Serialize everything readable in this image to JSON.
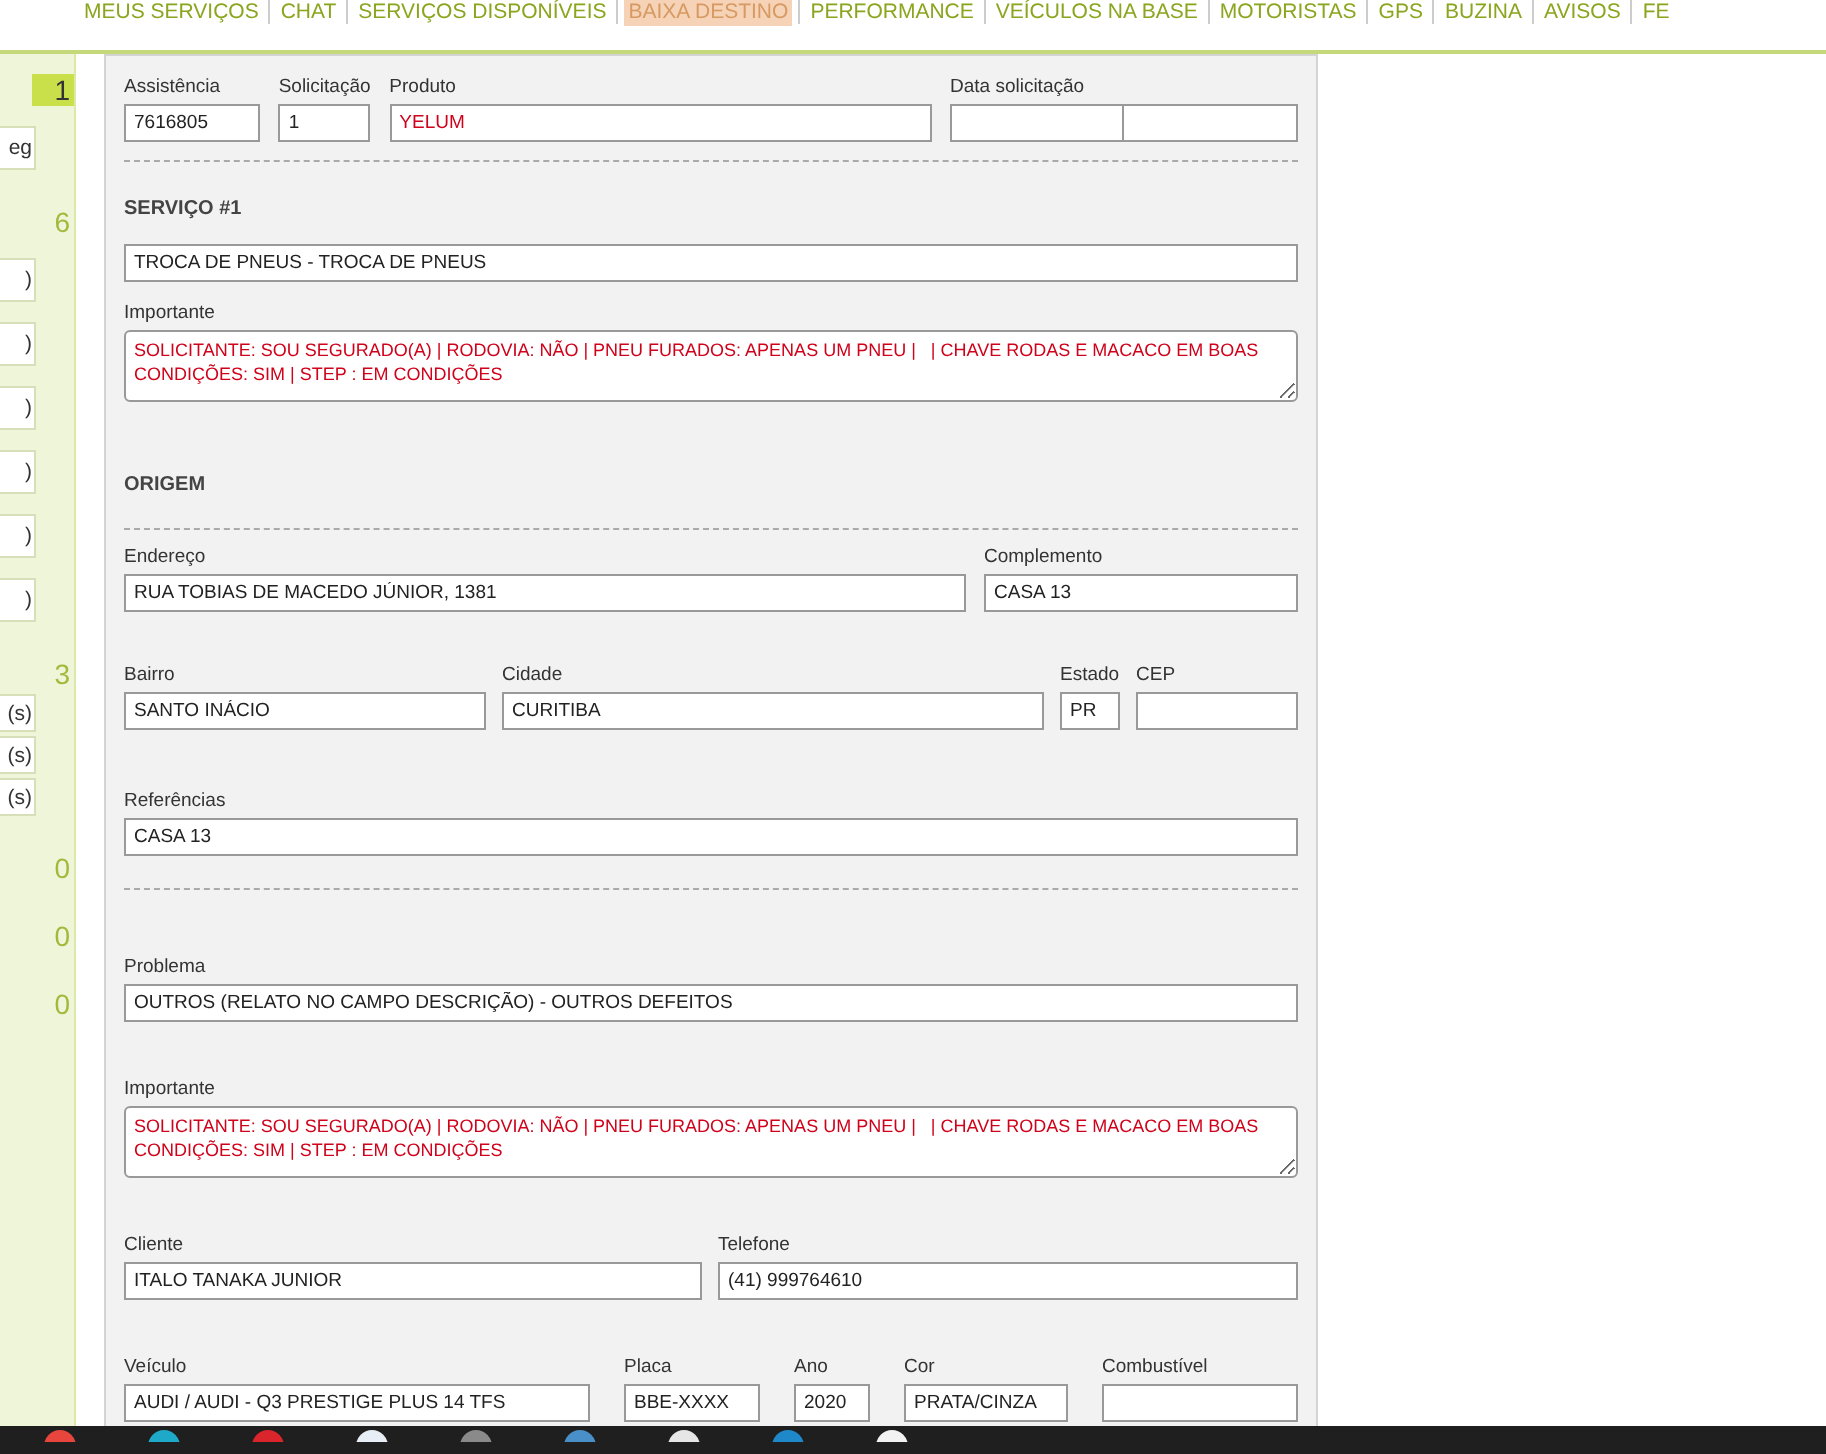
{
  "nav": [
    {
      "label": "MEUS SERVIÇOS",
      "selected": false
    },
    {
      "label": "CHAT",
      "selected": false
    },
    {
      "label": "SERVIÇOS DISPONÍVEIS",
      "selected": false
    },
    {
      "label": "BAIXA DESTINO",
      "selected": true
    },
    {
      "label": "PERFORMANCE",
      "selected": false
    },
    {
      "label": "VEÍCULOS NA BASE",
      "selected": false
    },
    {
      "label": "MOTORISTAS",
      "selected": false
    },
    {
      "label": "GPS",
      "selected": false
    },
    {
      "label": "BUZINA",
      "selected": false
    },
    {
      "label": "AVISOS",
      "selected": false
    },
    {
      "label": "FE",
      "selected": false
    }
  ],
  "sidebar": [
    {
      "kind": "count",
      "text": "1",
      "highlighted": true
    },
    {
      "kind": "box",
      "text": "eg"
    },
    {
      "kind": "count",
      "text": "6",
      "highlighted": false
    },
    {
      "kind": "box",
      "text": ")"
    },
    {
      "kind": "box",
      "text": ")"
    },
    {
      "kind": "box",
      "text": ")"
    },
    {
      "kind": "box",
      "text": ")"
    },
    {
      "kind": "box",
      "text": ")"
    },
    {
      "kind": "box",
      "text": ")"
    },
    {
      "kind": "count",
      "text": "3",
      "highlighted": false
    },
    {
      "kind": "small",
      "text": "(s)"
    },
    {
      "kind": "small",
      "text": "(s)"
    },
    {
      "kind": "small",
      "text": "(s)"
    },
    {
      "kind": "count",
      "text": "0",
      "highlighted": false
    },
    {
      "kind": "count",
      "text": "0",
      "highlighted": false
    },
    {
      "kind": "count",
      "text": "0",
      "highlighted": false
    }
  ],
  "form": [
    {
      "kind": "fields",
      "fields": [
        {
          "kind": "input",
          "label": "Assistência",
          "value": "7616805",
          "alert": false
        },
        {
          "kind": "input",
          "label": "Solicitação",
          "value": "1",
          "alert": false
        },
        {
          "kind": "input",
          "label": "Produto",
          "value": "YELUM",
          "alert": true
        },
        {
          "kind": "split",
          "label": "Data solicitação"
        }
      ]
    },
    {
      "kind": "divider"
    },
    {
      "kind": "heading",
      "text": "SERVIÇO #1"
    },
    {
      "kind": "fields",
      "fields": [
        {
          "kind": "input",
          "value": "TROCA DE PNEUS - TROCA DE PNEUS",
          "alert": false
        }
      ]
    },
    {
      "kind": "fields",
      "fields": [
        {
          "kind": "textarea",
          "label": "Importante",
          "value": "SOLICITANTE: SOU SEGURADO(A) | RODOVIA: NÃO | PNEU FURADOS: APENAS UM PNEU |   | CHAVE RODAS E MACACO EM BOAS CONDIÇÕES: SIM | STEP : EM CONDIÇÕES",
          "alert": true
        }
      ]
    },
    {
      "kind": "heading",
      "text": "ORIGEM"
    },
    {
      "kind": "divider"
    },
    {
      "kind": "fields",
      "fields": [
        {
          "kind": "input",
          "label": "Endereço",
          "value": "RUA TOBIAS DE MACEDO JÚNIOR, 1381",
          "alert": false
        },
        {
          "kind": "input",
          "label": "Complemento",
          "value": "CASA 13",
          "alert": false
        }
      ]
    },
    {
      "kind": "fields",
      "fields": [
        {
          "kind": "input",
          "label": "Bairro",
          "value": "SANTO INÁCIO",
          "alert": false
        },
        {
          "kind": "input",
          "label": "Cidade",
          "value": "CURITIBA",
          "alert": false
        },
        {
          "kind": "input",
          "label": "Estado",
          "value": "PR",
          "alert": false
        },
        {
          "kind": "input",
          "label": "CEP"
        }
      ]
    },
    {
      "kind": "fields",
      "fields": [
        {
          "kind": "input",
          "label": "Referências",
          "value": "CASA 13",
          "alert": false
        }
      ]
    },
    {
      "kind": "divider"
    },
    {
      "kind": "fields",
      "fields": [
        {
          "kind": "input",
          "label": "Problema",
          "value": "OUTROS (RELATO NO CAMPO DESCRIÇÃO) - OUTROS DEFEITOS",
          "alert": false
        }
      ]
    },
    {
      "kind": "fields",
      "fields": [
        {
          "kind": "textarea",
          "label": "Importante",
          "value": "SOLICITANTE: SOU SEGURADO(A) | RODOVIA: NÃO | PNEU FURADOS: APENAS UM PNEU |   | CHAVE RODAS E MACACO EM BOAS CONDIÇÕES: SIM | STEP : EM CONDIÇÕES",
          "alert": true
        }
      ]
    },
    {
      "kind": "fields",
      "fields": [
        {
          "kind": "input",
          "label": "Cliente",
          "value": "ITALO TANAKA JUNIOR",
          "alert": false
        },
        {
          "kind": "input",
          "label": "Telefone",
          "value": "(41) 999764610",
          "alert": false
        }
      ]
    },
    {
      "kind": "fields",
      "fields": [
        {
          "kind": "input",
          "label": "Veículo",
          "value": "AUDI / AUDI - Q3 PRESTIGE PLUS 14 TFS",
          "alert": false
        },
        {
          "kind": "input",
          "label": "Placa",
          "value": "BBE-XXXX",
          "alert": false
        },
        {
          "kind": "input",
          "label": "Ano",
          "value": "2020",
          "alert": false
        },
        {
          "kind": "input",
          "label": "Cor",
          "value": "PRATA/CINZA",
          "alert": false
        },
        {
          "kind": "input",
          "label": "Combustível"
        }
      ]
    }
  ],
  "taskbar": [
    {
      "color": "#e8453c"
    },
    {
      "color": "#1fa9c9"
    },
    {
      "color": "#d9252b"
    },
    {
      "color": "#e8eef5"
    },
    {
      "color": "#8a8a8a"
    },
    {
      "color": "#4a90c8"
    },
    {
      "color": "#e6e6e6"
    },
    {
      "color": "#1f88c9"
    },
    {
      "color": "#f2f2f2"
    }
  ]
}
